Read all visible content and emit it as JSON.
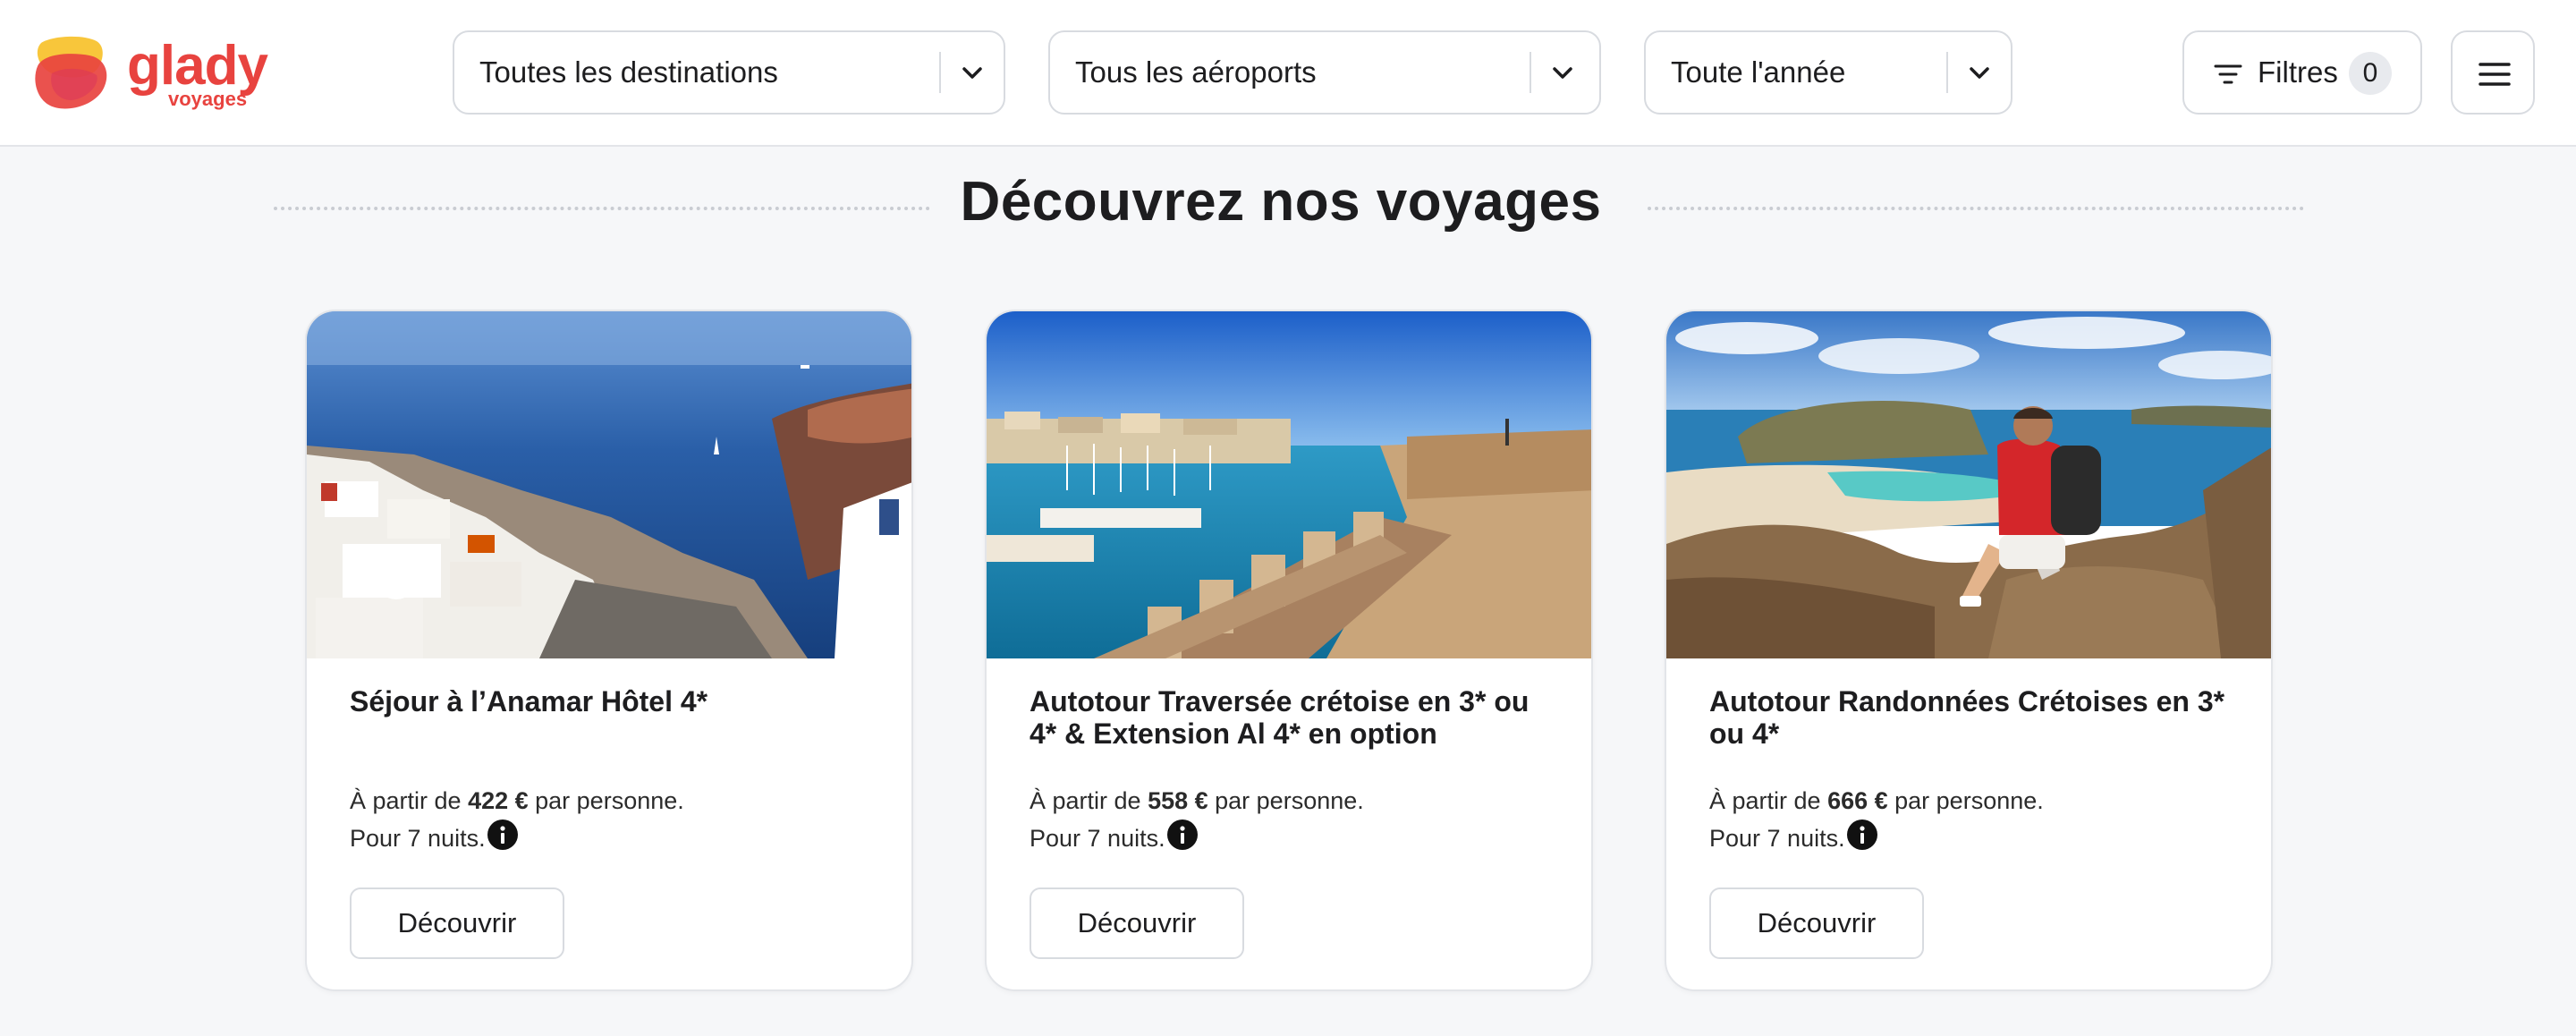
{
  "brand": {
    "name": "glady",
    "subname": "voyages",
    "colors": {
      "primary": "#e8433f",
      "secondary": "#f8c63b"
    }
  },
  "header": {
    "destination_select": {
      "value": "Toutes les destinations",
      "icon": "chevron-down-icon"
    },
    "airport_select": {
      "value": "Tous les aéroports",
      "icon": "chevron-down-icon"
    },
    "period_select": {
      "value": "Toute l'année",
      "icon": "chevron-down-icon"
    },
    "filters": {
      "label": "Filtres",
      "count": "0",
      "icon": "filter-icon"
    },
    "menu": {
      "icon": "hamburger-menu-icon"
    }
  },
  "main": {
    "section_title": "Découvrez nos voyages",
    "cards": [
      {
        "title": "Séjour à l’Anamar Hôtel 4*",
        "price_prefix": "À partir de ",
        "price": "422 €",
        "price_suffix": " par personne.",
        "nights": "Pour 7 nuits.",
        "button_label": "Découvrir",
        "image": "santorini-cliff-sea-photo"
      },
      {
        "title": "Autotour Traversée crétoise en 3* ou 4* & Extension Al 4* en option",
        "price_prefix": "À partir de ",
        "price": "558 €",
        "price_suffix": " par personne.",
        "nights": "Pour 7 nuits.",
        "button_label": "Découvrir",
        "image": "heraklion-fortress-harbor-photo"
      },
      {
        "title": "Autotour Randonnées Crétoises en 3* ou 4*",
        "price_prefix": "À partir de ",
        "price": "666 €",
        "price_suffix": " par personne.",
        "nights": "Pour 7 nuits.",
        "button_label": "Découvrir",
        "image": "hiker-balos-lagoon-photo"
      }
    ]
  }
}
